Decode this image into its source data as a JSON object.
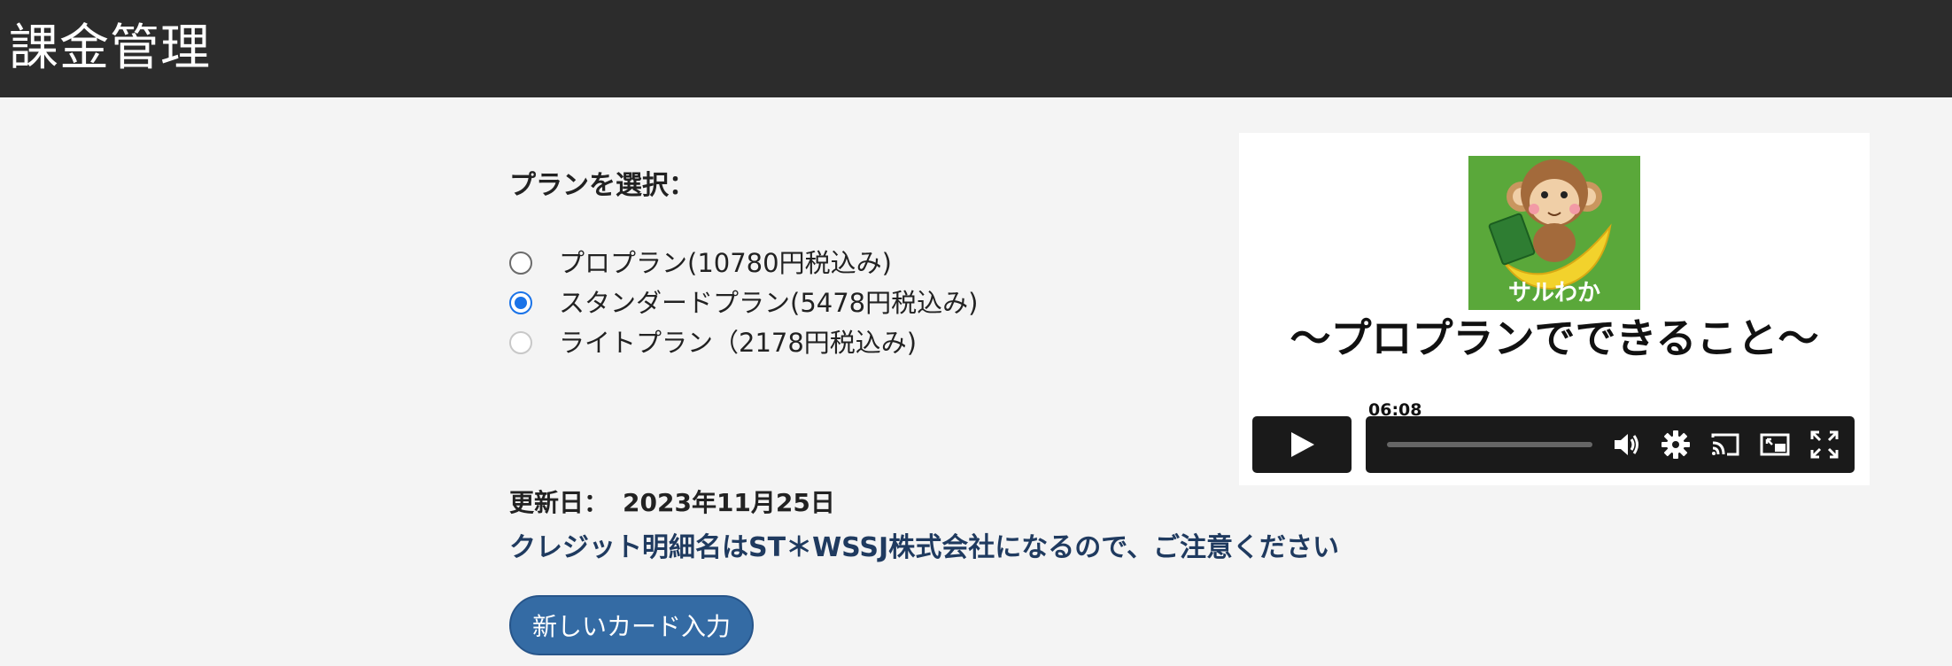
{
  "header": {
    "title": "課金管理"
  },
  "plan_section": {
    "heading": "プランを選択：",
    "plans": [
      {
        "label": "プロプラン(10780円税込み)",
        "state": "unchecked"
      },
      {
        "label": "スタンダードプラン(5478円税込み)",
        "state": "checked"
      },
      {
        "label": "ライトプラン（2178円税込み)",
        "state": "disabled"
      }
    ]
  },
  "update": {
    "label": "更新日：",
    "date": "2023年11月25日"
  },
  "notice": "クレジット明細名はST＊WSSJ株式会社になるので、ご注意ください",
  "new_card_button": "新しいカード入力",
  "video": {
    "thumbnail_brand": "サルわか",
    "title": "～プロプランでできること～",
    "duration_tooltip": "06:08",
    "controls": [
      "play-icon",
      "volume-icon",
      "settings-icon",
      "cast-icon",
      "picture-in-picture-icon",
      "fullscreen-icon"
    ]
  },
  "colors": {
    "header_bg": "#2c2c2c",
    "page_bg": "#f4f4f4",
    "accent_radio": "#1a73e8",
    "notice_text": "#1f3a5f",
    "button_bg": "#346ba4",
    "thumbnail_green": "#5aa83a"
  }
}
